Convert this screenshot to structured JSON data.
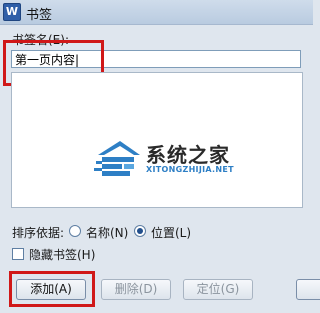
{
  "window": {
    "title": "书签",
    "icon": "w-app-icon"
  },
  "bookmark_name": {
    "label": "书签名(E):",
    "value": "第一页内容|"
  },
  "watermark": {
    "title": "系统之家",
    "subtitle": "XITONGZHIJIA.NET"
  },
  "sort": {
    "label": "排序依据:",
    "options": [
      {
        "label": "名称(N)",
        "selected": false
      },
      {
        "label": "位置(L)",
        "selected": true
      }
    ]
  },
  "hidden_bookmarks": {
    "label": "隐藏书签(H)",
    "checked": false
  },
  "buttons": {
    "add": "添加(A)",
    "delete": "删除(D)",
    "goto": "定位(G)"
  },
  "colors": {
    "highlight": "#d01818",
    "accent": "#2e7fc5"
  }
}
